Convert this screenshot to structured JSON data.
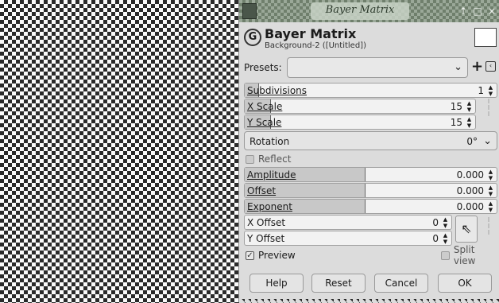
{
  "window": {
    "title": "Bayer Matrix",
    "buttons": [
      "↑",
      "□",
      "×"
    ]
  },
  "header": {
    "title": "Bayer Matrix",
    "subtitle": "Background-2 ([Untitled])"
  },
  "presets": {
    "label": "Presets:",
    "value": "",
    "add_label": "+",
    "menu_icon": "‹"
  },
  "params": {
    "subdivisions": {
      "label": "Subdivisions",
      "value": "1"
    },
    "x_scale": {
      "label": "X Scale",
      "value": "15"
    },
    "y_scale": {
      "label": "Y Scale",
      "value": "15"
    },
    "rotation": {
      "label": "Rotation",
      "value": "0°"
    },
    "reflect": {
      "label": "Reflect",
      "checked": false
    },
    "amplitude": {
      "label": "Amplitude",
      "value": "0.000"
    },
    "offset": {
      "label": "Offset",
      "value": "0.000"
    },
    "exponent": {
      "label": "Exponent",
      "value": "0.000"
    },
    "x_offset": {
      "label": "X Offset",
      "value": "0"
    },
    "y_offset": {
      "label": "Y Offset",
      "value": "0"
    }
  },
  "options": {
    "preview": {
      "label": "Preview",
      "checked": true
    },
    "split_view": {
      "label": "Split view",
      "checked": false
    }
  },
  "actions": {
    "help": "Help",
    "reset": "Reset",
    "cancel": "Cancel",
    "ok": "OK"
  },
  "glyphs": {
    "spin_up": "▲",
    "spin_down": "▼",
    "chevron": "⌄",
    "check": "✓",
    "chain": "⁝",
    "pointer": "⇖",
    "gimp": "G"
  }
}
